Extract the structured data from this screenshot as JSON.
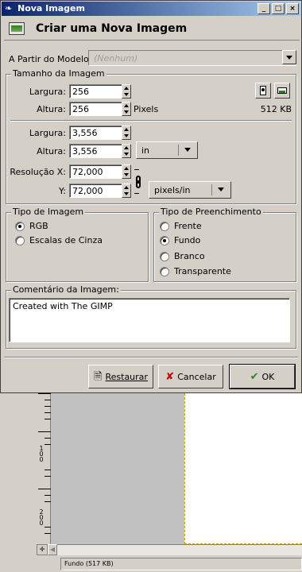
{
  "dialog": {
    "window_title": "Nova Imagem",
    "header": "Criar uma Nova Imagem",
    "titlebar_buttons": {
      "minimize": "_",
      "maximize": "□",
      "close": "×"
    }
  },
  "template": {
    "label": "A Partir do Modelo:",
    "value": "(Nenhum)"
  },
  "image_size": {
    "legend": "Tamanho da Imagem",
    "width_label": "Largura:",
    "width_value": "256",
    "height_label": "Altura:",
    "height_value": "256",
    "pixels_unit": "Pixels",
    "memory": "512 KB",
    "print_width_label": "Largura:",
    "print_width_value": "3,556",
    "print_height_label": "Altura:",
    "print_height_value": "3,556",
    "print_unit": "in",
    "res_x_label": "Resolução X:",
    "res_x_value": "72,000",
    "res_y_label": "Y:",
    "res_y_value": "72,000",
    "res_unit": "pixels/in"
  },
  "image_type": {
    "legend": "Tipo de Imagem",
    "options": [
      {
        "label": "RGB",
        "selected": true
      },
      {
        "label": "Escalas de Cinza",
        "selected": false
      }
    ]
  },
  "fill_type": {
    "legend": "Tipo de Preenchimento",
    "options": [
      {
        "label": "Frente",
        "selected": false
      },
      {
        "label": "Fundo",
        "selected": true
      },
      {
        "label": "Branco",
        "selected": false
      },
      {
        "label": "Transparente",
        "selected": false
      }
    ]
  },
  "comment": {
    "legend": "Comentário da Imagem:",
    "value": "Created with The GIMP"
  },
  "buttons": {
    "reset": "Restaurar",
    "cancel": "Cancelar",
    "ok": "OK"
  },
  "background_window": {
    "ruler_labels": [
      "1 0 0",
      "2 0 0"
    ],
    "status": "Fundo (517 KB)"
  },
  "colors": {
    "titlebar_start": "#0a246a",
    "titlebar_end": "#a6caf0",
    "dialog_bg": "#d4d0c8"
  }
}
